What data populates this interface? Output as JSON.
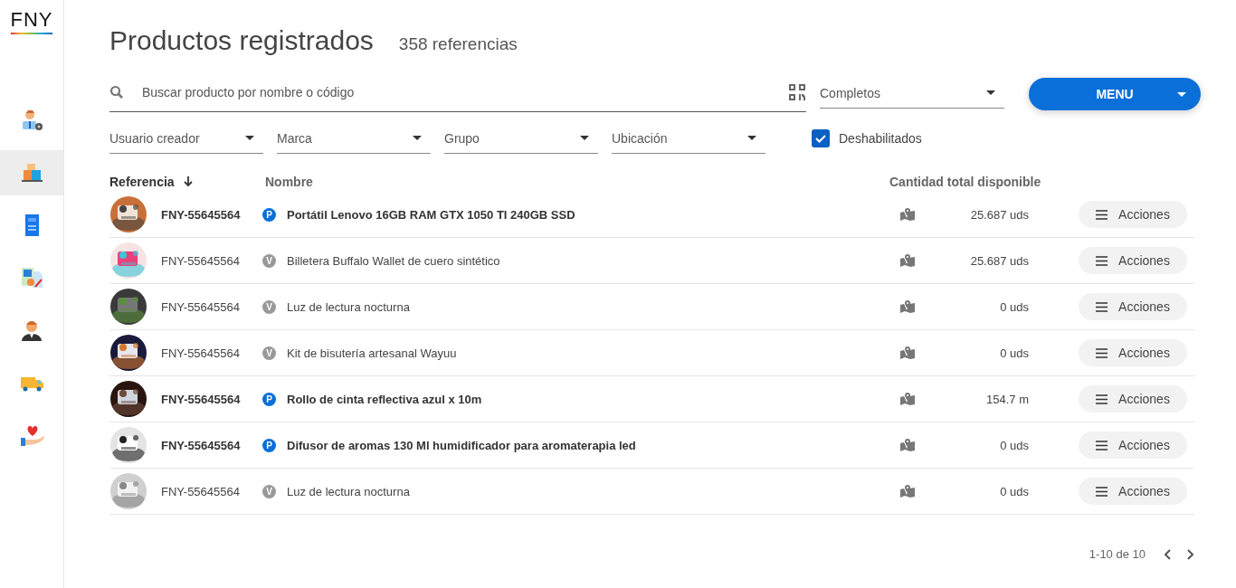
{
  "logo": {
    "text": "FNY"
  },
  "sidebar": {
    "items": [
      {
        "kind": "admin",
        "selected": false
      },
      {
        "kind": "boxes",
        "selected": true
      },
      {
        "kind": "receipt",
        "selected": false
      },
      {
        "kind": "calculator",
        "selected": false
      },
      {
        "kind": "agent",
        "selected": false
      },
      {
        "kind": "truck",
        "selected": false
      },
      {
        "kind": "charity",
        "selected": false
      }
    ]
  },
  "header": {
    "title": "Productos registrados",
    "count": "358 referencias"
  },
  "search": {
    "placeholder": "Buscar producto por nombre o código"
  },
  "status_select": {
    "value": "Completos"
  },
  "menu_button": {
    "label": "MENU"
  },
  "filters": [
    {
      "placeholder": "Usuario creador"
    },
    {
      "placeholder": "Marca"
    },
    {
      "placeholder": "Grupo"
    },
    {
      "placeholder": "Ubicación"
    }
  ],
  "disabled_filter": {
    "label": "Deshabilitados",
    "checked": true
  },
  "table": {
    "columns": [
      "Referencia",
      "Nombre",
      "Cantidad total disponible"
    ],
    "rows": [
      {
        "reference": "FNY-55645564",
        "kind": "p",
        "badge": "P",
        "name": "Portátil Lenovo 16GB RAM GTX 1050 TI 240GB SSD",
        "quantity": "25.687 uds",
        "action": "Acciones"
      },
      {
        "reference": "FNY-55645564",
        "kind": "v",
        "badge": "V",
        "name": "Billetera Buffalo Wallet de cuero sintético",
        "quantity": "25.687 uds",
        "action": "Acciones"
      },
      {
        "reference": "FNY-55645564",
        "kind": "v",
        "badge": "V",
        "name": "Luz de lectura nocturna",
        "quantity": "0 uds",
        "action": "Acciones"
      },
      {
        "reference": "FNY-55645564",
        "kind": "v",
        "badge": "V",
        "name": "Kit de bisutería artesanal Wayuu",
        "quantity": "0 uds",
        "action": "Acciones"
      },
      {
        "reference": "FNY-55645564",
        "kind": "p",
        "badge": "P",
        "name": "Rollo de cinta reflectiva azul x 10m",
        "quantity": "154.7 m",
        "action": "Acciones"
      },
      {
        "reference": "FNY-55645564",
        "kind": "p",
        "badge": "P",
        "name": "Difusor de aromas 130 Ml humidificador para aromaterapia led",
        "quantity": "0 uds",
        "action": "Acciones"
      },
      {
        "reference": "FNY-55645564",
        "kind": "v",
        "badge": "V",
        "name": "Luz de lectura nocturna",
        "quantity": "0 uds",
        "action": "Acciones"
      }
    ]
  },
  "pagination": {
    "range": "1-10 de 10"
  }
}
